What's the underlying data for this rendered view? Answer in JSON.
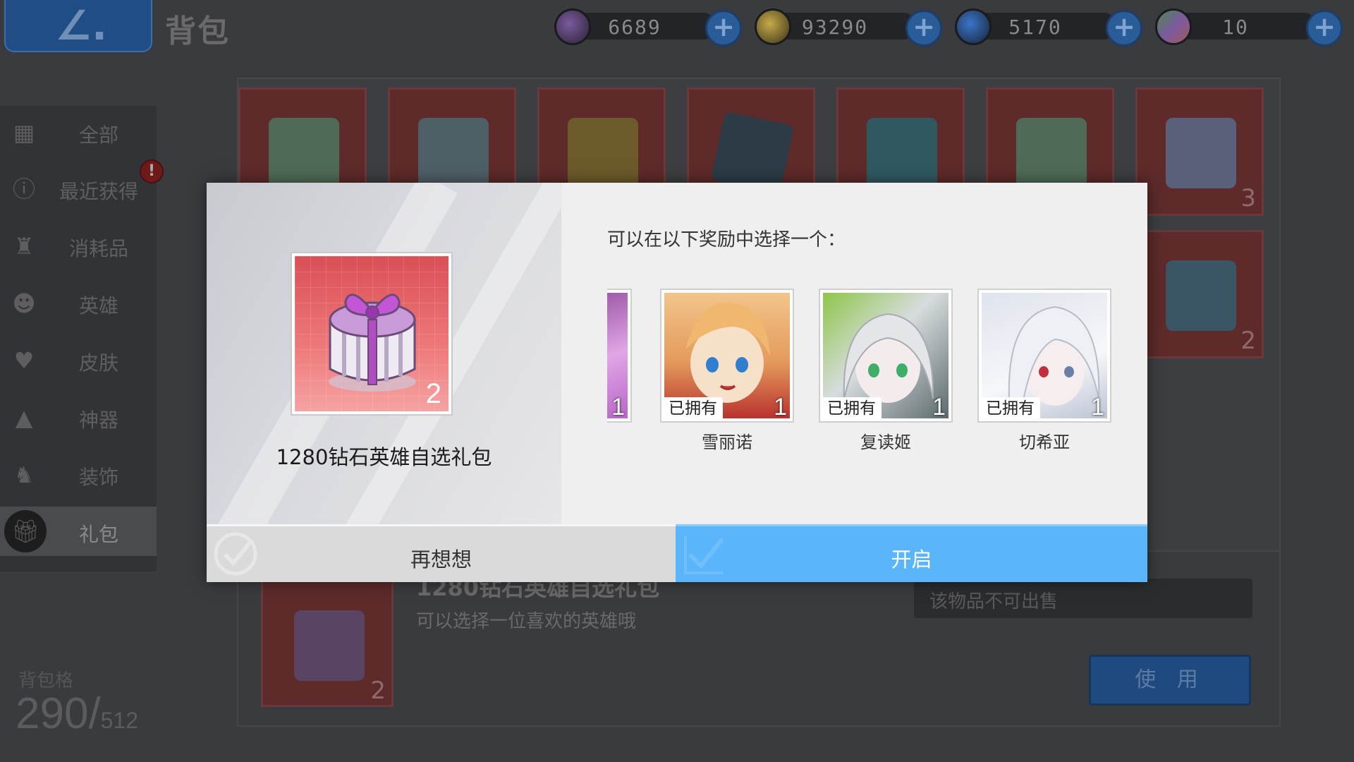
{
  "header": {
    "title": "背包",
    "back_icon": "back-chevron-icon"
  },
  "resources": [
    {
      "name": "key",
      "icon": "key-icon",
      "value": "6689",
      "color": "#6b4a8c"
    },
    {
      "name": "gold",
      "icon": "gold-coin-icon",
      "value": "93290",
      "color": "#b59a3a"
    },
    {
      "name": "crystal",
      "icon": "blue-crystal-icon",
      "value": "5170",
      "color": "#2e5fa8"
    },
    {
      "name": "rainbow",
      "icon": "rainbow-crystal-icon",
      "value": "10",
      "color": "#7a5aa0"
    }
  ],
  "sidebar": {
    "items": [
      {
        "label": "全部",
        "icon": "grid-icon"
      },
      {
        "label": "最近获得",
        "icon": "info-icon"
      },
      {
        "label": "消耗品",
        "icon": "potion-icon"
      },
      {
        "label": "英雄",
        "icon": "hero-icon"
      },
      {
        "label": "皮肤",
        "icon": "shirt-icon"
      },
      {
        "label": "神器",
        "icon": "artifact-icon"
      },
      {
        "label": "装饰",
        "icon": "rocking-horse-icon"
      },
      {
        "label": "礼包",
        "icon": "gift-icon"
      }
    ],
    "active_index": 7,
    "new_badge": "!"
  },
  "capacity": {
    "label": "背包格",
    "used": "290/",
    "total": "512"
  },
  "grid": {
    "slots": [
      {
        "icon": "gift-box-green-icon",
        "count": ""
      },
      {
        "icon": "shopping-bag-icon",
        "count": ""
      },
      {
        "icon": "gift-box-gold-icon",
        "count": ""
      },
      {
        "icon": "hero-portrait-card-icon",
        "count": ""
      },
      {
        "icon": "paper-bag-icon",
        "count": ""
      },
      {
        "icon": "gift-box-green-icon",
        "count": ""
      },
      {
        "icon": "gift-box-blue-icon",
        "count": "3"
      },
      {
        "icon": "toy-box-icon",
        "count": "2"
      }
    ]
  },
  "detail": {
    "name": "1280钻石英雄自选礼包",
    "description": "可以选择一位喜欢的英雄哦",
    "count": "2",
    "sell_status": "该物品不可出售",
    "use_label": "使 用"
  },
  "modal": {
    "item_name": "1280钻石英雄自选礼包",
    "item_count": "2",
    "item_icon": "purple-gift-box-icon",
    "prompt": "可以在以下奖励中选择一个：",
    "choices": [
      {
        "name": "",
        "owned_label": "",
        "count": "1",
        "palette": [
          "#c06acb",
          "#e7a8e8"
        ]
      },
      {
        "name": "雪丽诺",
        "owned_label": "已拥有",
        "count": "1",
        "palette": [
          "#e9a86a",
          "#f5d3a2"
        ]
      },
      {
        "name": "复读姬",
        "owned_label": "已拥有",
        "count": "1",
        "palette": [
          "#7fc24a",
          "#d8dde0"
        ]
      },
      {
        "name": "切希亚",
        "owned_label": "已拥有",
        "count": "1",
        "palette": [
          "#c9d0df",
          "#f0f2f7"
        ]
      }
    ],
    "cancel_label": "再想想",
    "confirm_label": "开启",
    "confirm_color": "#5ab5fa"
  }
}
